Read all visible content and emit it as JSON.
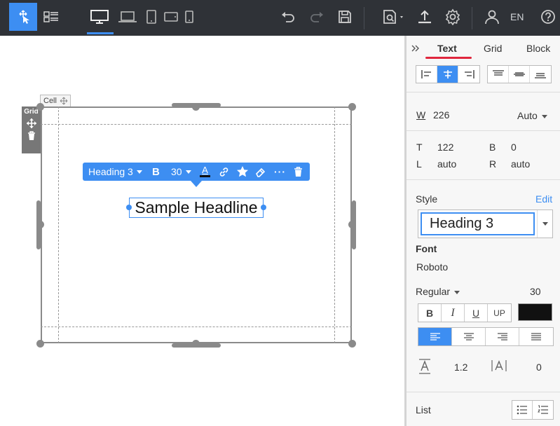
{
  "toolbar": {
    "language": "EN"
  },
  "canvas": {
    "cell_label": "Cell",
    "grid_label": "Grid",
    "headline_text": "Sample Headline"
  },
  "text_toolbar": {
    "style": "Heading 3",
    "bold": "B",
    "size": "30",
    "font_color_glyph": "A",
    "more": "···"
  },
  "panel": {
    "tabs": [
      "Text",
      "Grid",
      "Block"
    ],
    "active_tab": "Text",
    "width_label": "W",
    "width_value": "226",
    "width_unit": "Auto",
    "position": {
      "t_label": "T",
      "t_value": "122",
      "b_label": "B",
      "b_value": "0",
      "l_label": "L",
      "l_value": "auto",
      "r_label": "R",
      "r_value": "auto"
    },
    "style_label": "Style",
    "edit_link": "Edit",
    "style_value": "Heading 3",
    "font_label": "Font",
    "font_value": "Roboto",
    "weight_value": "Regular",
    "size_value": "30",
    "format_buttons": [
      "B",
      "I",
      "U",
      "UP"
    ],
    "text_color": "#111111",
    "line_height_value": "1.2",
    "letter_spacing_value": "0",
    "list_label": "List"
  },
  "colors": {
    "accent": "#3d8ef2",
    "toolbar_bg": "#2f3237",
    "tab_underline": "#e0263d"
  }
}
